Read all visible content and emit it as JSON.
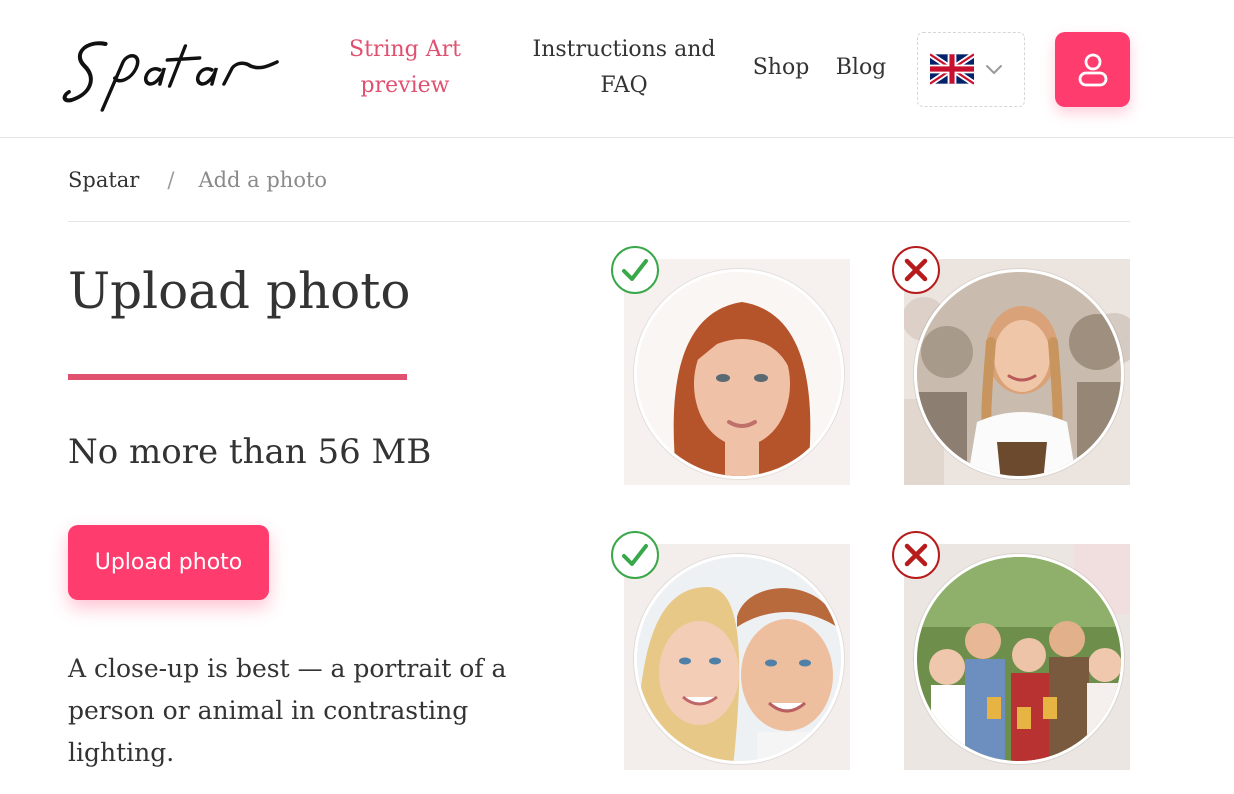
{
  "header": {
    "logo_text": "Spatar",
    "nav": [
      {
        "label": "String Art preview",
        "active": true
      },
      {
        "label": "Instructions and FAQ",
        "active": false
      },
      {
        "label": "Shop",
        "active": false
      },
      {
        "label": "Blog",
        "active": false
      }
    ],
    "language": {
      "flag_icon": "uk-flag-icon",
      "selector_icon": "chevron-down-icon"
    },
    "user_icon": "user-icon"
  },
  "breadcrumb": {
    "home": "Spatar",
    "separator": "/",
    "current": "Add a photo"
  },
  "main": {
    "title": "Upload photo",
    "size_limit": "No more than 56 MB",
    "upload_label": "Upload photo",
    "hint": "A close-up is best — a portrait of a person or animal in contrasting lighting."
  },
  "examples": [
    {
      "verdict": "good",
      "icon": "check-icon",
      "subject": "single-face-portrait"
    },
    {
      "verdict": "bad",
      "icon": "cross-icon",
      "subject": "girl-with-braids-busy-background"
    },
    {
      "verdict": "good",
      "icon": "check-icon",
      "subject": "couple-close-up"
    },
    {
      "verdict": "bad",
      "icon": "cross-icon",
      "subject": "group-of-people"
    }
  ],
  "colors": {
    "accent": "#ff3c6e",
    "accent_text": "#e0506f",
    "ok": "#3aa84a",
    "bad": "#b71c1c"
  }
}
